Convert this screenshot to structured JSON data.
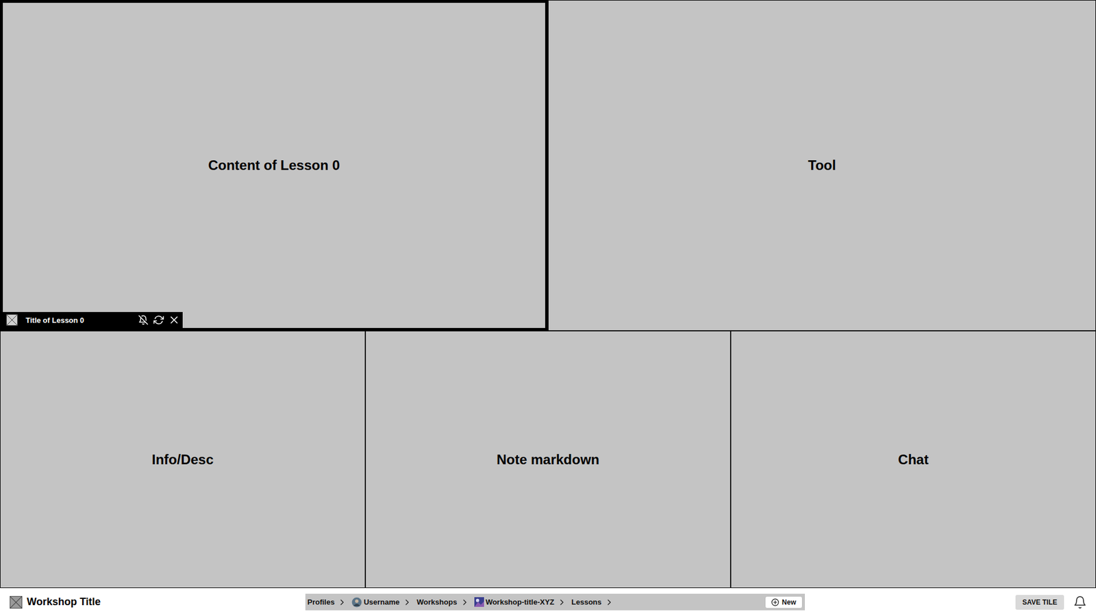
{
  "top_row": [
    {
      "label": "Content of Lesson 0",
      "title": "Title of Lesson 0",
      "selected": true
    },
    {
      "label": "Tool",
      "title": "",
      "selected": false
    }
  ],
  "bottom_row": [
    {
      "label": "Info/Desc",
      "title": "",
      "selected": false
    },
    {
      "label": "Note markdown",
      "title": "",
      "selected": false
    },
    {
      "label": "Chat",
      "title": "",
      "selected": false
    }
  ],
  "bottom_bar": {
    "workshop_title": "Workshop Title",
    "breadcrumb": [
      {
        "label": "Profiles",
        "kind": "plain"
      },
      {
        "label": "Username",
        "kind": "user-avatar"
      },
      {
        "label": "Workshops",
        "kind": "plain"
      },
      {
        "label": "Workshop-title-XYZ",
        "kind": "workshop-avatar"
      },
      {
        "label": "Lessons",
        "kind": "plain"
      }
    ],
    "new_button": "New",
    "save_button": "SAVE TILE"
  }
}
